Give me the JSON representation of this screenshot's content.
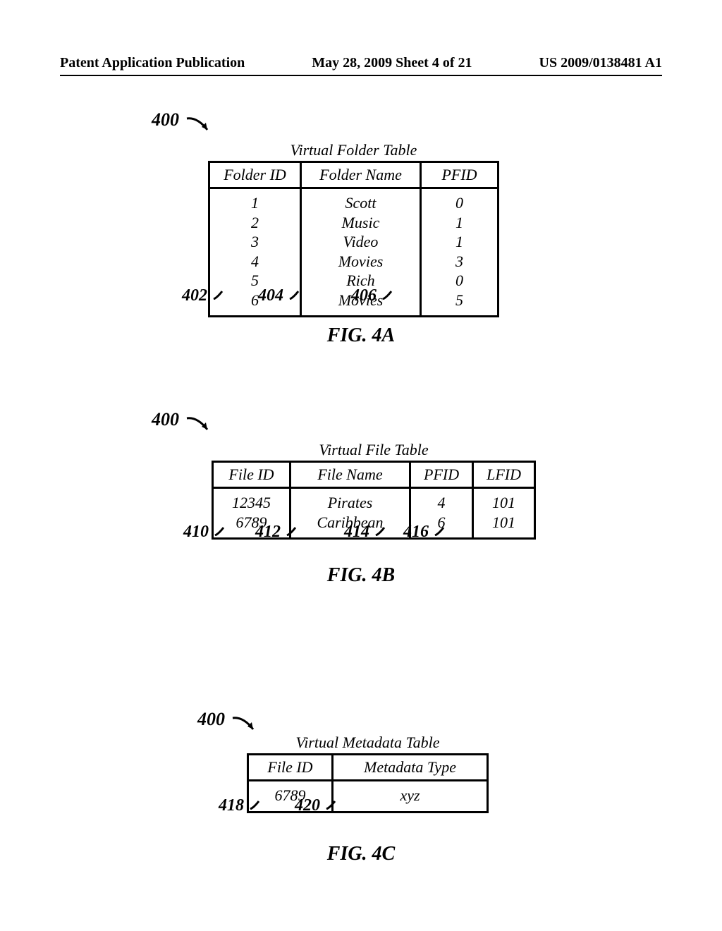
{
  "header": {
    "left": "Patent Application Publication",
    "middle": "May 28, 2009  Sheet 4 of 21",
    "right": "US 2009/0138481 A1"
  },
  "figA": {
    "ref400": "400",
    "title": "Virtual Folder Table",
    "headers": {
      "c1": "Folder ID",
      "c2": "Folder Name",
      "c3": "PFID"
    },
    "col1": {
      "r1": "1",
      "r2": "2",
      "r3": "3",
      "r4": "4",
      "r5": "5",
      "r6": "6"
    },
    "col2": {
      "r1": "Scott",
      "r2": "Music",
      "r3": "Video",
      "r4": "Movies",
      "r5": "Rich",
      "r6": "Movies"
    },
    "col3": {
      "r1": "0",
      "r2": "1",
      "r3": "1",
      "r4": "3",
      "r5": "0",
      "r6": "5"
    },
    "callouts": {
      "a": "402",
      "b": "404",
      "c": "406"
    },
    "caption": "FIG. 4A"
  },
  "figB": {
    "ref400": "400",
    "title": "Virtual File Table",
    "headers": {
      "c1": "File ID",
      "c2": "File Name",
      "c3": "PFID",
      "c4": "LFID"
    },
    "col1": {
      "r1": "12345",
      "r2": "6789"
    },
    "col2": {
      "r1": "Pirates",
      "r2": "Caribbean"
    },
    "col3": {
      "r1": "4",
      "r2": "6"
    },
    "col4": {
      "r1": "101",
      "r2": "101"
    },
    "callouts": {
      "a": "410",
      "b": "412",
      "c": "414",
      "d": "416"
    },
    "caption": "FIG. 4B"
  },
  "figC": {
    "ref400": "400",
    "title": "Virtual Metadata Table",
    "headers": {
      "c1": "File ID",
      "c2": "Metadata Type"
    },
    "row": {
      "c1": "6789",
      "c2": "xyz"
    },
    "callouts": {
      "a": "418",
      "b": "420"
    },
    "caption": "FIG. 4C"
  },
  "chart_data": [
    {
      "type": "table",
      "title": "Virtual Folder Table",
      "columns": [
        "Folder ID",
        "Folder Name",
        "PFID"
      ],
      "rows": [
        [
          1,
          "Scott",
          0
        ],
        [
          2,
          "Music",
          1
        ],
        [
          3,
          "Video",
          1
        ],
        [
          4,
          "Movies",
          3
        ],
        [
          5,
          "Rich",
          0
        ],
        [
          6,
          "Movies",
          5
        ]
      ],
      "column_refs": {
        "Folder ID": 402,
        "Folder Name": 404,
        "PFID": 406
      },
      "figure_ref": 400,
      "figure_label": "FIG. 4A"
    },
    {
      "type": "table",
      "title": "Virtual File Table",
      "columns": [
        "File ID",
        "File Name",
        "PFID",
        "LFID"
      ],
      "rows": [
        [
          12345,
          "Pirates",
          4,
          101
        ],
        [
          6789,
          "Caribbean",
          6,
          101
        ]
      ],
      "column_refs": {
        "File ID": 410,
        "File Name": 412,
        "PFID": 414,
        "LFID": 416
      },
      "figure_ref": 400,
      "figure_label": "FIG. 4B"
    },
    {
      "type": "table",
      "title": "Virtual Metadata Table",
      "columns": [
        "File ID",
        "Metadata Type"
      ],
      "rows": [
        [
          6789,
          "xyz"
        ]
      ],
      "column_refs": {
        "File ID": 418,
        "Metadata Type": 420
      },
      "figure_ref": 400,
      "figure_label": "FIG. 4C"
    }
  ]
}
